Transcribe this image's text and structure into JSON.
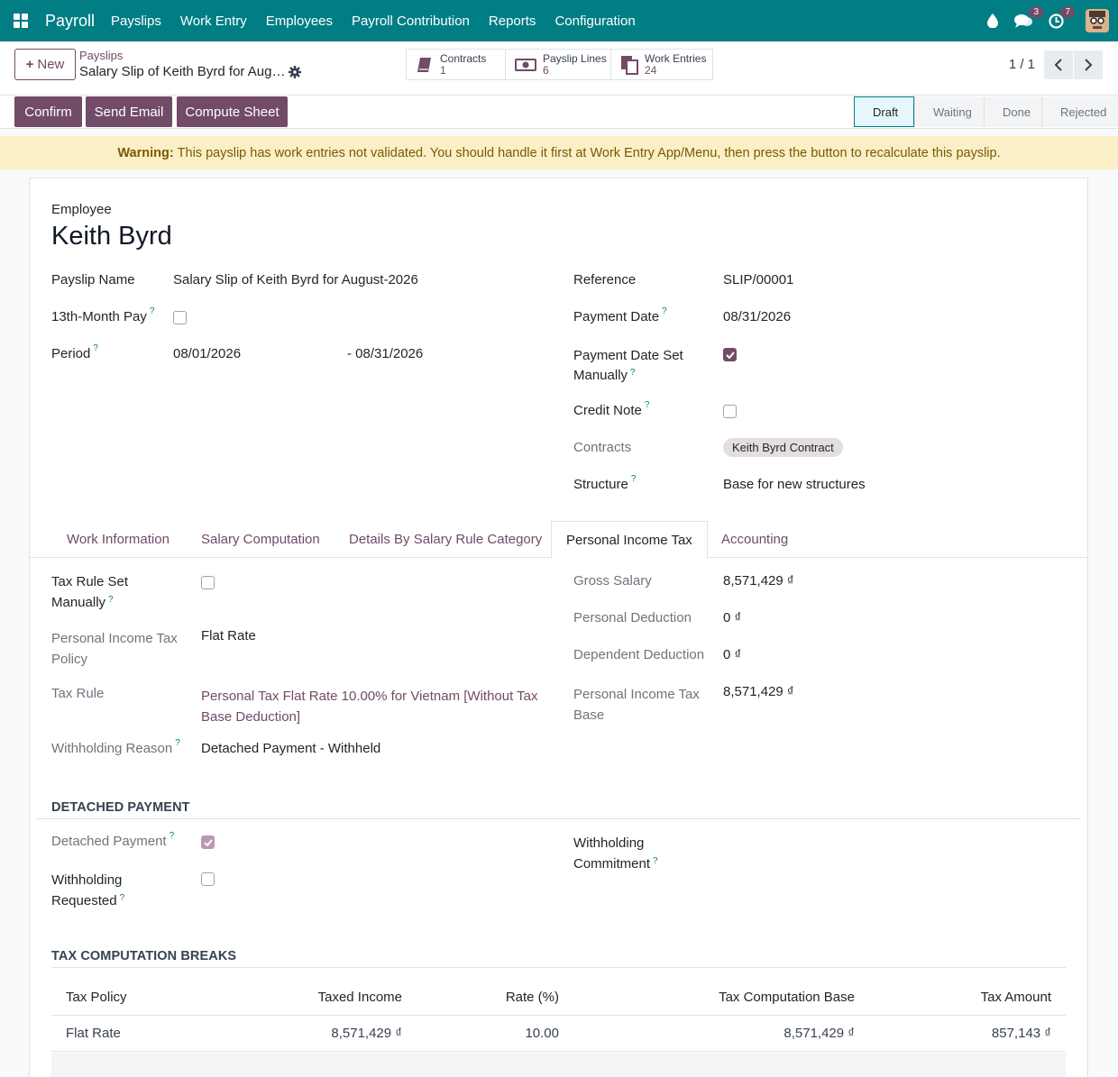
{
  "navbar": {
    "brand": "Payroll",
    "menu": [
      "Payslips",
      "Work Entry",
      "Employees",
      "Payroll Contribution",
      "Reports",
      "Configuration"
    ],
    "messages_count": "3",
    "activities_count": "7"
  },
  "control_panel": {
    "new_label": "New",
    "breadcrumb_parent": "Payslips",
    "breadcrumb_current": "Salary Slip of Keith Byrd for Aug…",
    "smart_buttons": [
      {
        "label": "Contracts",
        "value": "1",
        "icon": "book-icon"
      },
      {
        "label": "Payslip Lines",
        "value": "6",
        "icon": "money-icon"
      },
      {
        "label": "Work Entries",
        "value": "24",
        "icon": "files-icon"
      }
    ],
    "pager": "1 / 1"
  },
  "statusbar": {
    "actions": [
      "Confirm",
      "Send Email",
      "Compute Sheet"
    ],
    "stages": [
      "Draft",
      "Waiting",
      "Done",
      "Rejected"
    ],
    "active_stage": "Draft"
  },
  "warning": {
    "title": "Warning:",
    "text": "This payslip has work entries not validated. You should handle it first at Work Entry App/Menu, then press the button to recalculate this payslip."
  },
  "form": {
    "employee_label": "Employee",
    "employee_name": "Keith Byrd",
    "payslip_name_label": "Payslip Name",
    "payslip_name": "Salary Slip of Keith Byrd for August-2026",
    "thirteenth_label": "13th-Month Pay",
    "thirteenth_checked": false,
    "period_label": "Period",
    "period_from": "08/01/2026",
    "period_to": "- 08/31/2026",
    "reference_label": "Reference",
    "reference": "SLIP/00001",
    "payment_date_label": "Payment Date",
    "payment_date": "08/31/2026",
    "payment_date_manual_label_1": "Payment Date Set",
    "payment_date_manual_label_2": "Manually",
    "payment_date_manual_checked": true,
    "credit_note_label": "Credit Note",
    "credit_note_checked": false,
    "contracts_label": "Contracts",
    "contract_tag": "Keith Byrd Contract",
    "structure_label": "Structure",
    "structure": "Base for new structures"
  },
  "tabs": [
    "Work Information",
    "Salary Computation",
    "Details By Salary Rule Category",
    "Personal Income Tax",
    "Accounting"
  ],
  "active_tab": "Personal Income Tax",
  "pit": {
    "tax_rule_manual_label_1": "Tax Rule Set",
    "tax_rule_manual_label_2": "Manually",
    "pit_policy_label_1": "Personal Income Tax",
    "pit_policy_label_2": "Policy",
    "pit_policy": "Flat Rate",
    "tax_rule_label": "Tax Rule",
    "tax_rule_1": "Personal Tax Flat Rate 10.00% for Vietnam [Without Tax",
    "tax_rule_2": "Base Deduction]",
    "withholding_reason_label": "Withholding Reason",
    "withholding_reason": "Detached Payment - Withheld",
    "gross_salary_label": "Gross Salary",
    "gross_salary": "8,571,429 ₫",
    "personal_deduction_label": "Personal Deduction",
    "personal_deduction": "0 ₫",
    "dependent_deduction_label": "Dependent Deduction",
    "dependent_deduction": "0 ₫",
    "pit_base_label_1": "Personal Income Tax",
    "pit_base_label_2": "Base",
    "pit_base": "8,571,429 ₫"
  },
  "detached": {
    "title": "DETACHED PAYMENT",
    "detached_label": "Detached Payment",
    "withholding_requested_label_1": "Withholding",
    "withholding_requested_label_2": "Requested",
    "withholding_commitment_label_1": "Withholding",
    "withholding_commitment_label_2": "Commitment"
  },
  "breaks": {
    "title": "TAX COMPUTATION BREAKS",
    "columns": [
      "Tax Policy",
      "Taxed Income",
      "Rate (%)",
      "Tax Computation Base",
      "Tax Amount"
    ],
    "rows": [
      [
        "Flat Rate",
        "8,571,429 ₫",
        "10.00",
        "8,571,429 ₫",
        "857,143 ₫"
      ]
    ]
  }
}
